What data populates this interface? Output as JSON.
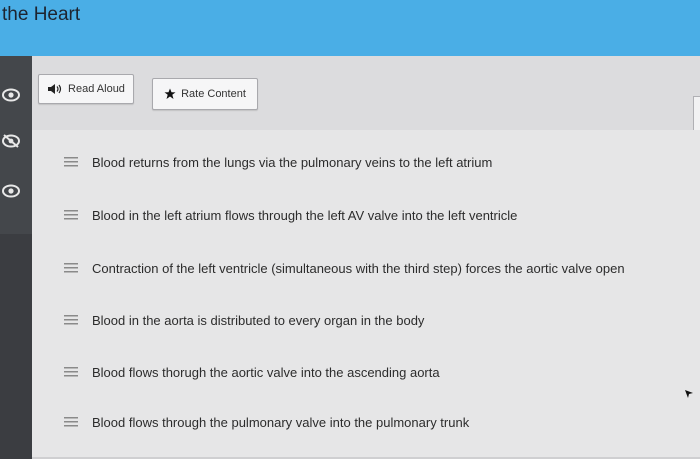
{
  "header": {
    "title": "the Heart",
    "color": "#4aaee6"
  },
  "toolbar": {
    "read_aloud_label": "Read Aloud",
    "read_aloud_icon": "speaker-icon",
    "rate_content_label": "Rate Content",
    "rate_content_icon": "star-icon"
  },
  "sidebar": {
    "icons": [
      "eye-icon",
      "eye-slash-icon",
      "eye-icon"
    ]
  },
  "list": {
    "items": [
      {
        "label": "Blood returns from the lungs via the pulmonary veins to the left atrium"
      },
      {
        "label": "Blood in the left atrium flows through the left AV valve into the left ventricle"
      },
      {
        "label": "Contraction of the left ventricle (simultaneous with the third step) forces the aortic valve open"
      },
      {
        "label": "Blood in the aorta is distributed to every organ in the body"
      },
      {
        "label": "Blood flows thorugh the aortic valve into the ascending aorta"
      },
      {
        "label": "Blood flows through the pulmonary valve into the pulmonary trunk"
      }
    ],
    "drag_handle_icon": "drag-handle-icon"
  }
}
